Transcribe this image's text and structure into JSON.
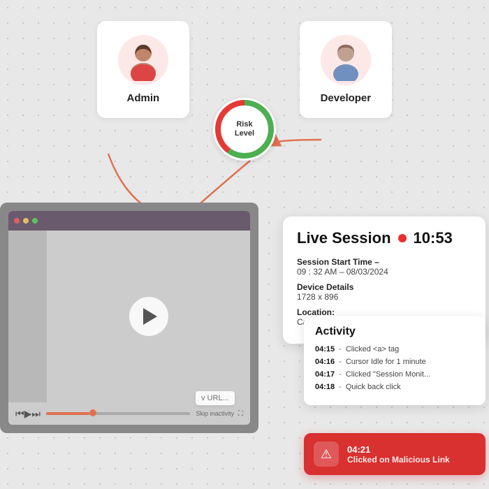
{
  "users": {
    "admin": {
      "label": "Admin",
      "avatar_type": "female"
    },
    "developer": {
      "label": "Developer",
      "avatar_type": "male"
    }
  },
  "risk": {
    "label_line1": "Risk",
    "label_line2": "Level"
  },
  "live_session": {
    "title": "Live Session",
    "time": "10:53",
    "session_start_label": "Session Start Time –",
    "session_start_value": "09 : 32 AM  –  08/03/2024",
    "device_label": "Device Details",
    "device_value": "1728 x 896",
    "location_label": "Location:",
    "location_value": "California,"
  },
  "activity": {
    "title": "Activity",
    "items": [
      {
        "time": "04:15",
        "desc": "Clicked <a> tag"
      },
      {
        "time": "04:16",
        "desc": "Cursor Idle for 1 minute"
      },
      {
        "time": "04:17",
        "desc": "Clicked \"Session Monit..."
      },
      {
        "time": "04:18",
        "desc": "Quick back click"
      }
    ]
  },
  "alert": {
    "time": "04:21",
    "desc": "Clicked on Malicious Link"
  },
  "video": {
    "skip_text": "Skip inactivity",
    "url_hint": "v URL..."
  }
}
